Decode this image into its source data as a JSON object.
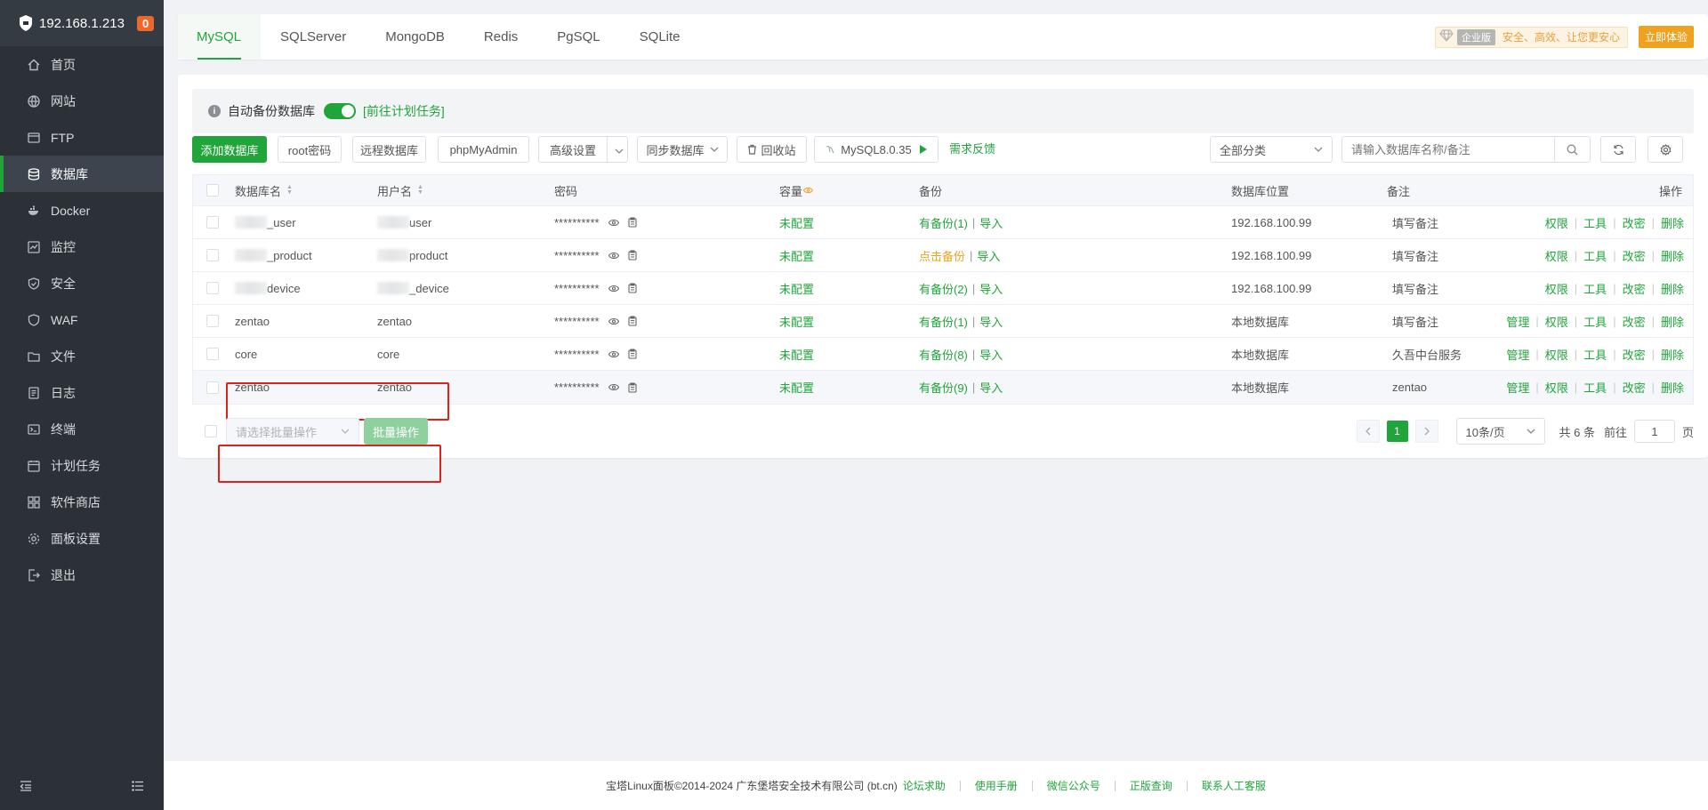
{
  "server": {
    "ip": "192.168.1.213",
    "badge": "0"
  },
  "sidebar": {
    "items": [
      {
        "label": "首页",
        "icon": "home-icon"
      },
      {
        "label": "网站",
        "icon": "globe-icon"
      },
      {
        "label": "FTP",
        "icon": "ftp-icon"
      },
      {
        "label": "数据库",
        "icon": "database-icon",
        "active": true
      },
      {
        "label": "Docker",
        "icon": "docker-icon"
      },
      {
        "label": "监控",
        "icon": "monitor-icon"
      },
      {
        "label": "安全",
        "icon": "shield-icon"
      },
      {
        "label": "WAF",
        "icon": "waf-icon"
      },
      {
        "label": "文件",
        "icon": "folder-icon"
      },
      {
        "label": "日志",
        "icon": "log-icon"
      },
      {
        "label": "终端",
        "icon": "terminal-icon"
      },
      {
        "label": "计划任务",
        "icon": "calendar-icon"
      },
      {
        "label": "软件商店",
        "icon": "apps-icon"
      },
      {
        "label": "面板设置",
        "icon": "gear-icon"
      },
      {
        "label": "退出",
        "icon": "logout-icon"
      }
    ]
  },
  "tabs": [
    "MySQL",
    "SQLServer",
    "MongoDB",
    "Redis",
    "PgSQL",
    "SQLite"
  ],
  "enterprise": {
    "vip": "企业版",
    "slogan": "安全、高效、让您更安心",
    "button": "立即体验"
  },
  "notice": {
    "label": "自动备份数据库",
    "link": "[前往计划任务]"
  },
  "toolbar": {
    "add": "添加数据库",
    "root_password": "root密码",
    "remote_db": "远程数据库",
    "phpmyadmin": "phpMyAdmin",
    "advanced": "高级设置",
    "sync": "同步数据库",
    "recycle": "回收站",
    "mysql_version": "MySQL8.0.35",
    "feedback": "需求反馈",
    "category": "全部分类",
    "search_placeholder": "请输入数据库名称/备注"
  },
  "table": {
    "headers": {
      "name": "数据库名",
      "user": "用户名",
      "password": "密码",
      "capacity": "容量",
      "backup": "备份",
      "location": "数据库位置",
      "remark": "备注",
      "ops": "操作"
    },
    "rows": [
      {
        "name": "_user",
        "user": "user",
        "password": "**********",
        "capacity": "未配置",
        "backup": "有备份(1)",
        "backup_style": "green",
        "import": "导入",
        "location": "192.168.100.99",
        "remark": "填写备注",
        "ops": [
          "权限",
          "工具",
          "改密",
          "删除"
        ],
        "blurred": true
      },
      {
        "name": "_product",
        "user": "product",
        "password": "**********",
        "capacity": "未配置",
        "backup": "点击备份",
        "backup_style": "orange",
        "import": "导入",
        "location": "192.168.100.99",
        "remark": "填写备注",
        "ops": [
          "权限",
          "工具",
          "改密",
          "删除"
        ],
        "blurred": true
      },
      {
        "name": "device",
        "user": "_device",
        "password": "**********",
        "capacity": "未配置",
        "backup": "有备份(2)",
        "backup_style": "green",
        "import": "导入",
        "location": "192.168.100.99",
        "remark": "填写备注",
        "ops": [
          "权限",
          "工具",
          "改密",
          "删除"
        ],
        "blurred": true
      },
      {
        "name": "zentao",
        "user": "zentao",
        "password": "**********",
        "capacity": "未配置",
        "backup": "有备份(1)",
        "backup_style": "green",
        "import": "导入",
        "location": "本地数据库",
        "remark": "填写备注",
        "ops": [
          "管理",
          "权限",
          "工具",
          "改密",
          "删除"
        ]
      },
      {
        "name": "core",
        "user": "core",
        "password": "**********",
        "capacity": "未配置",
        "backup": "有备份(8)",
        "backup_style": "green",
        "import": "导入",
        "location": "本地数据库",
        "remark": "久吾中台服务",
        "ops": [
          "管理",
          "权限",
          "工具",
          "改密",
          "删除"
        ]
      },
      {
        "name": "zentao",
        "user": "zentao",
        "password": "**********",
        "capacity": "未配置",
        "backup": "有备份(9)",
        "backup_style": "green",
        "import": "导入",
        "location": "本地数据库",
        "remark": "zentao",
        "ops": [
          "管理",
          "权限",
          "工具",
          "改密",
          "删除"
        ],
        "highlight": true
      }
    ]
  },
  "batch": {
    "placeholder": "请选择批量操作",
    "button": "批量操作"
  },
  "pager": {
    "current": "1",
    "page_size": "10条/页",
    "total": "共 6 条",
    "goto": "前往",
    "goto_value": "1",
    "page_unit": "页"
  },
  "footer": {
    "copyright": "宝塔Linux面板©2014-2024 广东堡塔安全技术有限公司 (bt.cn)",
    "links": [
      "论坛求助",
      "使用手册",
      "微信公众号",
      "正版查询",
      "联系人工客服"
    ]
  },
  "colors": {
    "accent": "#20a53a",
    "sidebar_bg": "#2c3138",
    "warning": "#f0a11f",
    "annotation": "#e0211b"
  }
}
